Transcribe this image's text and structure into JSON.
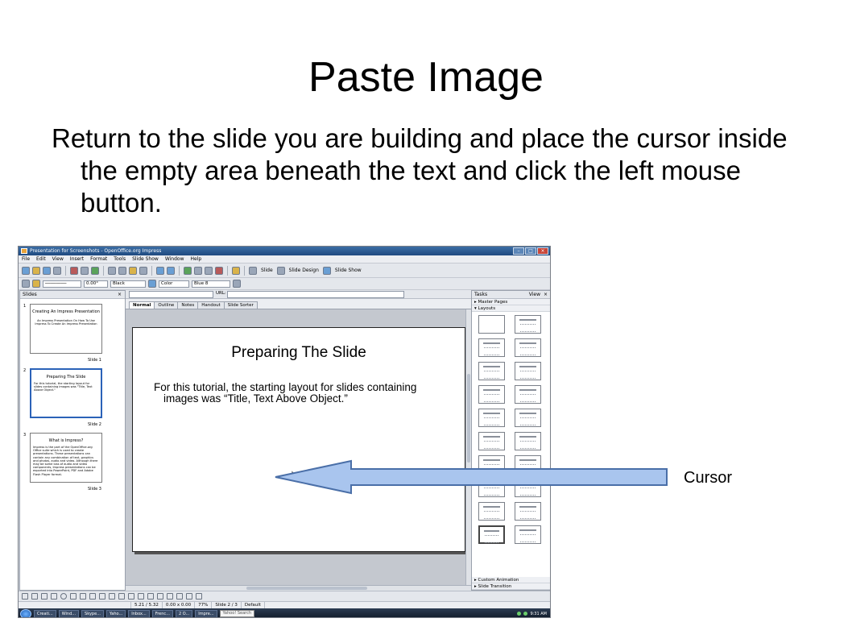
{
  "slide": {
    "title": "Paste Image",
    "body": "Return to the slide you are building and place the cursor inside the empty area beneath the text and click the left mouse button.",
    "annotation_label": "Cursor"
  },
  "window": {
    "title": "Presentation for Screenshots - OpenOffice.org Impress",
    "menu": [
      "File",
      "Edit",
      "View",
      "Insert",
      "Format",
      "Tools",
      "Slide Show",
      "Window",
      "Help"
    ]
  },
  "toolbar": {
    "slide_label": "Slide",
    "slide_design_label": "Slide Design",
    "slide_show_label": "Slide Show",
    "angle_value": "0.00°",
    "line_color": "Black",
    "fill_mode": "Color",
    "fill_color": "Blue 8",
    "url_label": "URL:"
  },
  "slides_pane": {
    "title": "Slides",
    "thumbs": [
      {
        "num": "1",
        "title": "Creating An Impress Presentation",
        "body": "An Impress Presentation On How To Use Impress To Create An Impress Presentation",
        "label": "Slide 1"
      },
      {
        "num": "2",
        "title": "Preparing The Slide",
        "body": "For this tutorial, the starting layout for slides containing images was \"Title, Text Above Object.\"",
        "label": "Slide 2"
      },
      {
        "num": "3",
        "title": "What is Impress?",
        "body": "Impress is the part of the OpenOffice.org Office suite which is used to create presentations. These presentations can contain any combination of text, graphics and photos, audio and video. Although there may be some loss of audio and video components, Impress presentations can be exported into PowerPoint, PDF and Adobe Flash Player format.",
        "label": "Slide 3"
      }
    ]
  },
  "view_tabs": [
    "Normal",
    "Outline",
    "Notes",
    "Handout",
    "Slide Sorter"
  ],
  "current_slide": {
    "title": "Preparing The Slide",
    "body": "For this tutorial, the starting layout for slides containing images was “Title, Text Above Object.”"
  },
  "tasks_pane": {
    "title": "Tasks",
    "view_label": "View",
    "sections": [
      "Master Pages",
      "Layouts"
    ],
    "footer_sections": [
      "Custom Animation",
      "Slide Transition"
    ]
  },
  "status": {
    "position": "5.21 / 5.32",
    "size": "0.00 x 0.00",
    "zoom": "77%",
    "slide": "Slide 2 / 3",
    "design": "Default"
  },
  "taskbar": {
    "items": [
      "Creati...",
      "Wind...",
      "Skype...",
      "Yaho...",
      "Inbox...",
      "Frenc...",
      "2 O...",
      "Impre..."
    ],
    "search": "Yahoo! Search",
    "clock": "9:31 AM"
  },
  "colors": {
    "arrow_fill": "#a9c5ee",
    "arrow_stroke": "#4a6fa8",
    "titlebar": "#2b5a92"
  }
}
